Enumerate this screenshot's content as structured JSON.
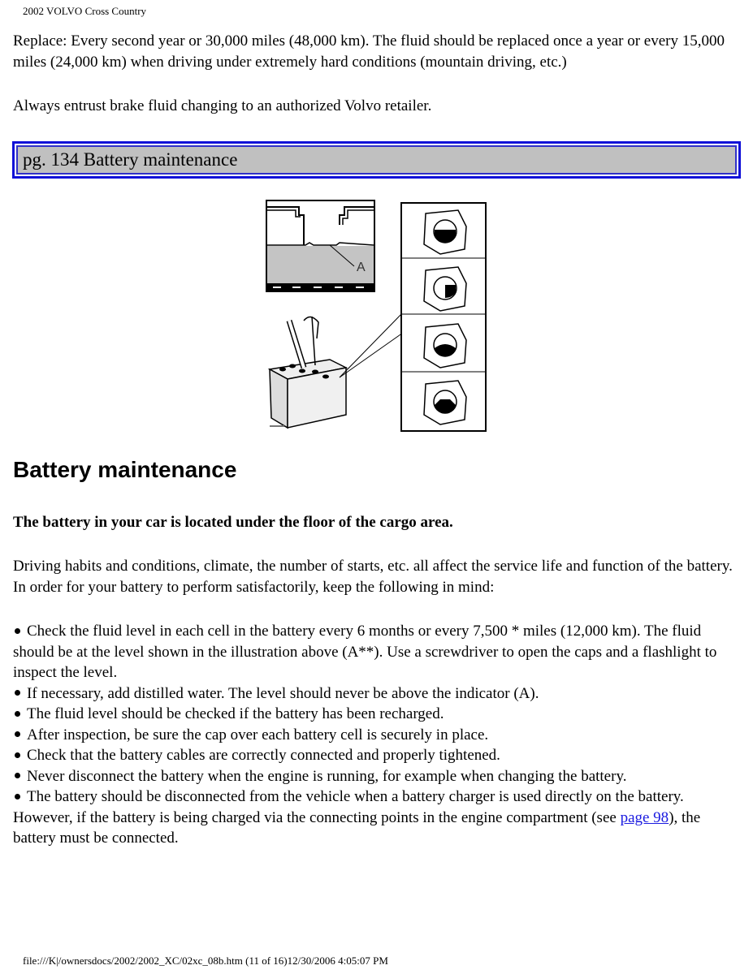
{
  "header": {
    "title": "2002 VOLVO Cross Country"
  },
  "intro": {
    "replace_text": "Replace: Every second year or 30,000 miles (48,000 km). The fluid should be replaced once a year or every 15,000 miles (24,000 km) when driving under extremely hard conditions (mountain driving, etc.)",
    "entrust_text": "Always entrust brake fluid changing to an authorized Volvo retailer."
  },
  "section_bar": {
    "label": "pg. 134 Battery maintenance"
  },
  "figure": {
    "label_a": "A",
    "description": "Battery fluid level illustration with cap inspection views"
  },
  "main": {
    "heading": "Battery maintenance",
    "location_text": "The battery in your car is located under the floor of the cargo area.",
    "habits_text": "Driving habits and conditions, climate, the number of starts, etc. all affect the service life and function of the battery. In order for your battery to perform satisfactorily, keep the following in mind:",
    "bullets": [
      "Check the fluid level in each cell in the battery every 6 months or every 7,500 * miles (12,000 km). The fluid should be at the level shown in the illustration above (A**). Use a screwdriver to open the caps and a flashlight to inspect the level.",
      "If necessary, add distilled water. The level should never be above the indicator (A).",
      "The fluid level should be checked if the battery has been recharged.",
      "After inspection, be sure the cap over each battery cell is securely in place.",
      "Check that the battery cables are correctly connected and properly tightened.",
      "Never disconnect the battery when the engine is running, for example when changing the battery."
    ],
    "last_bullet": {
      "before": "The battery should be disconnected from the vehicle when a battery charger is used directly on the battery. However, if the battery is being charged via the connecting points in the engine compartment (see ",
      "link": "page 98",
      "after": "), the battery must be connected."
    }
  },
  "footer": {
    "text": "file:///K|/ownersdocs/2002/2002_XC/02xc_08b.htm (11 of 16)12/30/2006 4:05:07 PM"
  }
}
